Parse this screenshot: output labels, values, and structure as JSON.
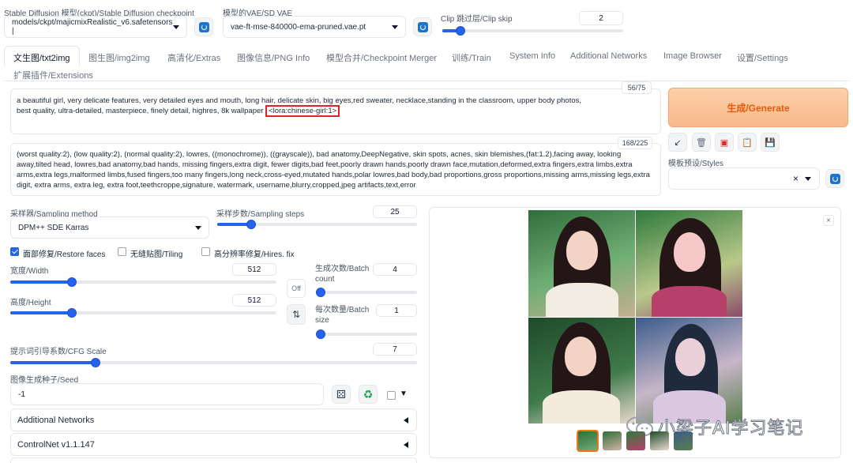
{
  "header": {
    "checkpoint_label": "Stable Diffusion 模型(ckpt)/Stable Diffusion checkpoint",
    "checkpoint_value": "models/ckpt/majicmixRealistic_v6.safetensors |",
    "vae_label": "模型的VAE/SD VAE",
    "vae_value": "vae-ft-mse-840000-ema-pruned.vae.pt",
    "clip_label": "Clip 跳过层/Clip skip",
    "clip_value": "2",
    "clip_fraction": 0.1
  },
  "tabs": [
    {
      "label": "文生图/txt2img",
      "active": true
    },
    {
      "label": "图生图/img2img"
    },
    {
      "label": "高清化/Extras"
    },
    {
      "label": "图像信息/PNG Info"
    },
    {
      "label": "模型合并/Checkpoint Merger"
    },
    {
      "label": "训练/Train"
    },
    {
      "label": "System Info"
    },
    {
      "label": "Additional Networks"
    },
    {
      "label": "Image Browser"
    },
    {
      "label": "设置/Settings"
    },
    {
      "label": "扩展插件/Extensions"
    }
  ],
  "prompt": {
    "text_line1": "a beautiful girl, very delicate features, very detailed eyes and mouth, long hair, delicate skin, big eyes,red sweater, necklace,standing in the classroom, upper body photos,",
    "text_line2": "best quality, ultra-detailed, masterpiece, finely detail, highres, 8k wallpaper",
    "lora_tag": "<lora:chinese-girl:1>",
    "counter": "56/75"
  },
  "negative_prompt": {
    "text": "(worst quality:2), (low quality:2), (normal quality:2), lowres, ((monochrome)), ((grayscale)), bad anatomy,DeepNegative, skin spots, acnes, skin blemishes,(fat:1.2),facing away, looking away,tilted head, lowres,bad anatomy,bad hands, missing fingers,extra digit, fewer digits,bad feet,poorly drawn hands,poorly drawn face,mutation,deformed,extra fingers,extra limbs,extra arms,extra legs,malformed limbs,fused fingers,too many fingers,long neck,cross-eyed,mutated hands,polar lowres,bad body,bad proportions,gross proportions,missing arms,missing legs,extra digit, extra arms, extra leg, extra foot,teethcroppe,signature, watermark, username,blurry,cropped,jpeg artifacts,text,error",
    "counter": "168/225"
  },
  "actions": {
    "generate_label": "生成/Generate",
    "styles_label": "模板预设/Styles",
    "styles_clear": "×",
    "tool_icons": [
      "arrow-icon",
      "trash-icon",
      "image-icon",
      "clipboard-icon",
      "save-icon"
    ],
    "tool_glyphs": [
      "↙",
      "🗑",
      "▣",
      "📋",
      "💾"
    ]
  },
  "settings": {
    "sampler_label": "采样器/Sampling method",
    "sampler_value": "DPM++ SDE Karras",
    "steps_label": "采样步数/Sampling steps",
    "steps_value": "25",
    "steps_fraction": 0.17,
    "restore_faces_label": "面部修复/Restore faces",
    "restore_faces_checked": true,
    "tiling_label": "无缝贴图/Tiling",
    "hires_label": "高分辨率修复/Hires. fix",
    "width_label": "宽度/Width",
    "width_value": "512",
    "width_fraction": 0.23,
    "height_label": "高度/Height",
    "height_value": "512",
    "height_fraction": 0.23,
    "off_label": "Off",
    "swap_glyph": "⇅",
    "batch_count_label": "生成次数/Batch count",
    "batch_count_value": "4",
    "batch_count_fraction": 0.03,
    "batch_size_label": "每次数量/Batch size",
    "batch_size_value": "1",
    "batch_size_fraction": 0.0,
    "cfg_label": "提示词引导系数/CFG Scale",
    "cfg_value": "7",
    "cfg_fraction": 0.21,
    "seed_label": "图像生成种子/Seed",
    "seed_value": "-1",
    "seed_dice_glyph": "⚄",
    "seed_recycle_glyph": "♻",
    "extra_glyph": "▼"
  },
  "accordions": [
    {
      "label": "Additional Networks"
    },
    {
      "label": "ControlNet v1.1.147"
    }
  ],
  "gallery": {
    "close_glyph": "×",
    "watermark": "小梁子AI学习笔记",
    "thumb_count": 5
  }
}
